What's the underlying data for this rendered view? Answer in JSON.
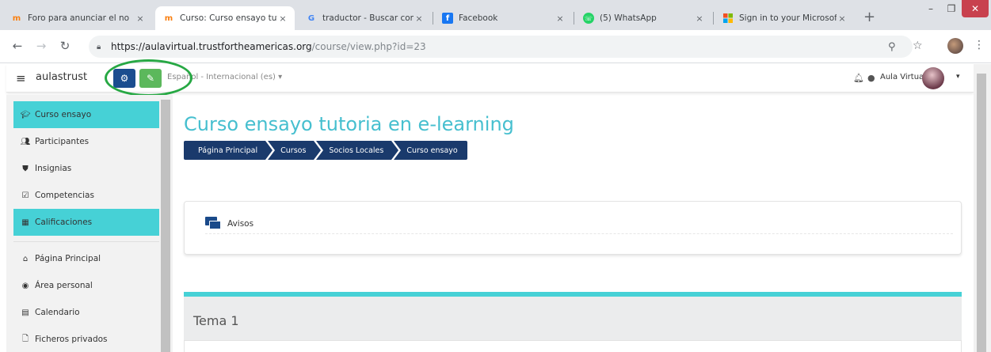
{
  "browser": {
    "tabs": [
      {
        "title": "Foro para anunciar el no",
        "icon": "moodle-icon"
      },
      {
        "title": "Curso: Curso ensayo tuto",
        "icon": "moodle-icon"
      },
      {
        "title": "traductor - Buscar con G",
        "icon": "google-icon"
      },
      {
        "title": "Facebook",
        "icon": "facebook-icon"
      },
      {
        "title": "(5) WhatsApp",
        "icon": "whatsapp-icon"
      },
      {
        "title": "Sign in to your Microsof",
        "icon": "microsoft-icon"
      }
    ],
    "close_glyph": "×",
    "new_tab_glyph": "+",
    "url_host": "https://aulavirtual.trustfortheamericas.org",
    "url_path": "/course/view.php?id=23"
  },
  "navbar": {
    "brand": "aulastrust",
    "language": "Español - Internacional (es)",
    "user_name": "Aula Virtual"
  },
  "drawer": {
    "items": [
      {
        "label": "Curso ensayo",
        "icon": "graduation-cap-icon",
        "active": true
      },
      {
        "label": "Participantes",
        "icon": "users-icon",
        "active": false
      },
      {
        "label": "Insignias",
        "icon": "shield-icon",
        "active": false
      },
      {
        "label": "Competencias",
        "icon": "checkbox-icon",
        "active": false
      },
      {
        "label": "Calificaciones",
        "icon": "table-icon",
        "active": true
      },
      {
        "label": "Página Principal",
        "icon": "home-icon",
        "active": false
      },
      {
        "label": "Área personal",
        "icon": "dashboard-icon",
        "active": false
      },
      {
        "label": "Calendario",
        "icon": "calendar-icon",
        "active": false
      },
      {
        "label": "Ficheros privados",
        "icon": "file-icon",
        "active": false
      }
    ]
  },
  "main": {
    "title": "Curso ensayo tutoria en e-learning",
    "breadcrumb": [
      "Página Principal",
      "Cursos",
      "Socios Locales",
      "Curso ensayo"
    ],
    "announcements_label": "Avisos",
    "section_title": "Tema 1"
  },
  "colors": {
    "accent_teal": "#46d1d6",
    "title_teal": "#46bfcf",
    "breadcrumb_navy": "#1a3a6c",
    "edit_green": "#5cb85c",
    "settings_blue": "#1b4d8f",
    "highlight_ring": "#27a844"
  }
}
